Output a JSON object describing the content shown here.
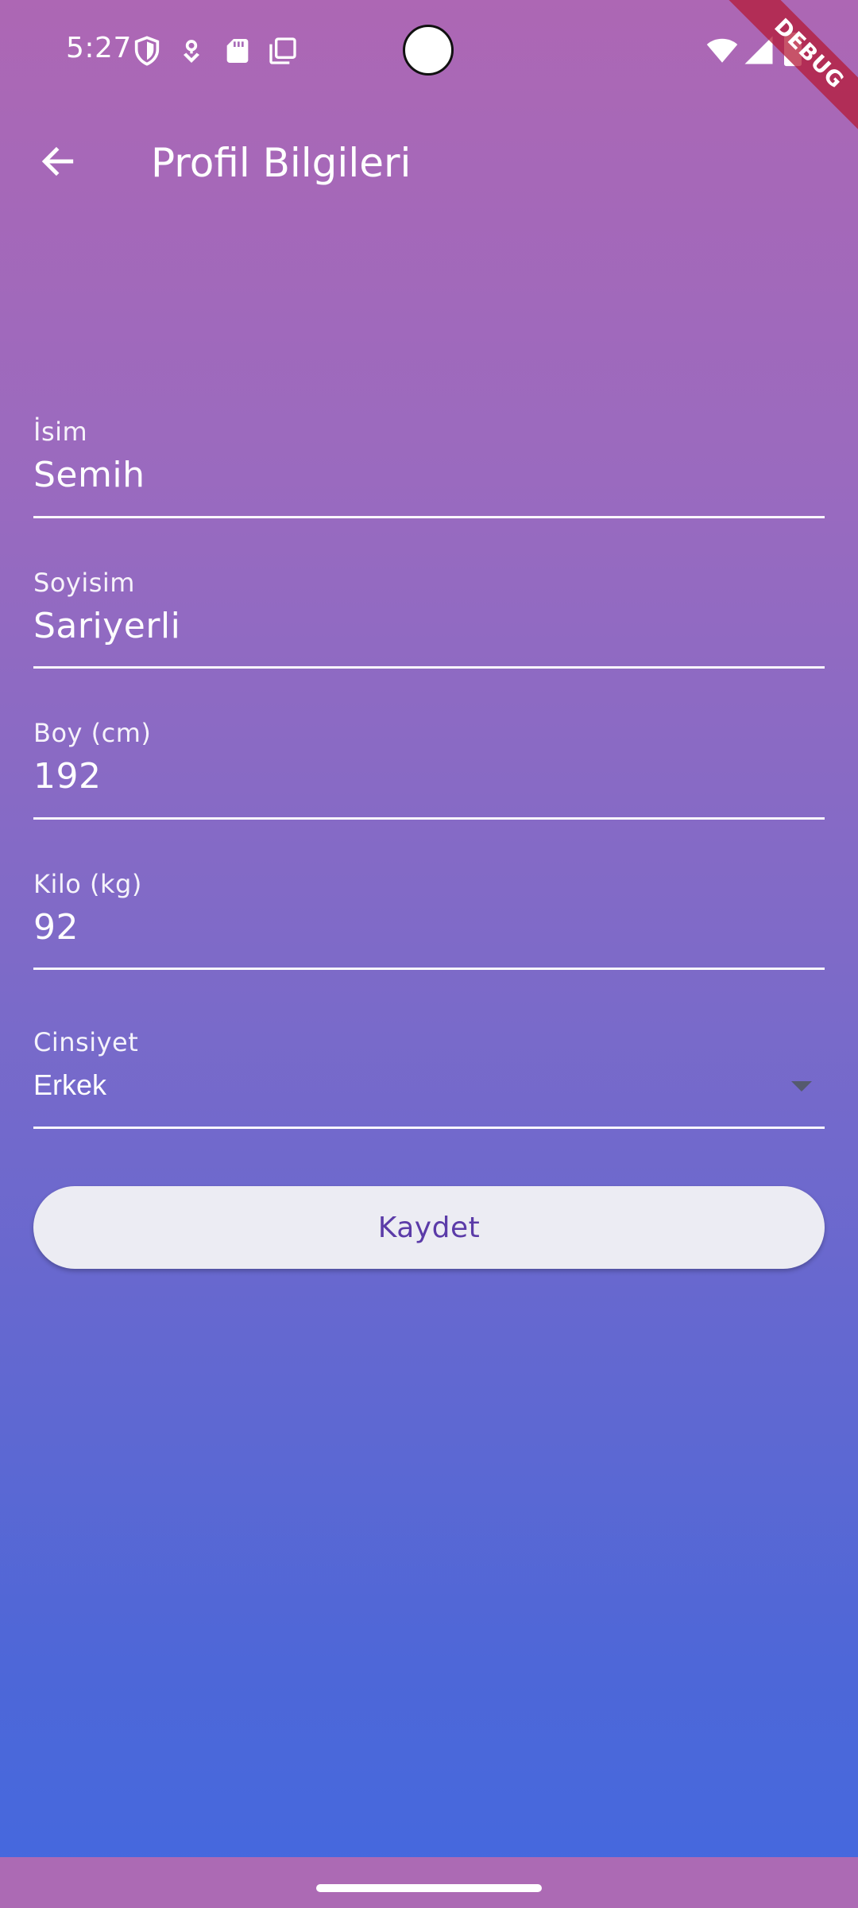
{
  "status_bar": {
    "time": "5:27",
    "icons_left": [
      "shield-icon",
      "location-pin-icon",
      "sd-card-icon",
      "screenshot-icon"
    ],
    "icons_right": [
      "wifi-icon",
      "cellular-signal-icon",
      "battery-icon"
    ]
  },
  "debug_banner": "DEBUG",
  "app_bar": {
    "title": "Profil Bilgileri",
    "back_icon": "arrow-back-icon"
  },
  "form": {
    "first_name": {
      "label": "İsim",
      "value": "Semih"
    },
    "last_name": {
      "label": "Soyisim",
      "value": "Sariyerli"
    },
    "height": {
      "label": "Boy (cm)",
      "value": "192"
    },
    "weight": {
      "label": "Kilo (kg)",
      "value": "92"
    },
    "gender": {
      "label": "Cinsiyet",
      "selected": "Erkek"
    }
  },
  "save_button": {
    "label": "Kaydet"
  },
  "colors": {
    "gradient_top": "#AD67B4",
    "gradient_bottom": "#4469DF",
    "button_background": "#ECECF3",
    "button_text": "#5B3BA8",
    "debug_ribbon": "#B41937"
  }
}
